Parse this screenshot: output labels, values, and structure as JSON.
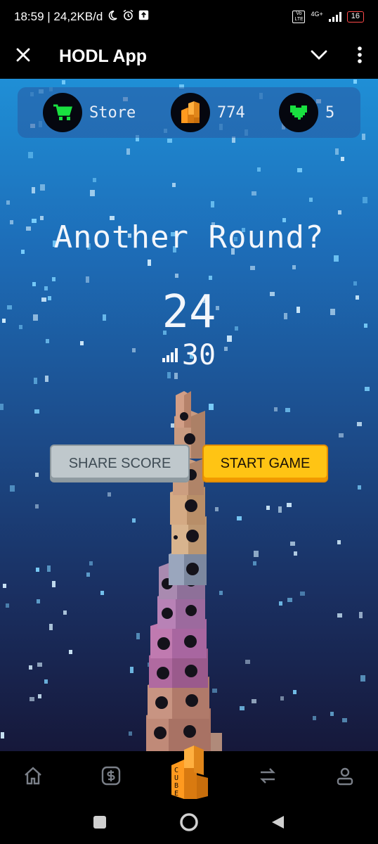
{
  "status_bar": {
    "time_speed": "18:59 | 24,2KB/d",
    "network": "4G+",
    "volte": "Vo LTE",
    "battery": "16"
  },
  "header": {
    "title": "HODL App",
    "close_icon": "close-icon",
    "chevron_icon": "chevron-down-icon",
    "menu_icon": "more-vertical-icon"
  },
  "stats": {
    "store_label": "Store",
    "cubes": "774",
    "lives": "5"
  },
  "game": {
    "headline": "Another Round?",
    "score": "24",
    "best": "30"
  },
  "buttons": {
    "share": "SHARE SCORE",
    "start": "START GAME"
  },
  "bottom_nav": {
    "items": [
      {
        "icon": "home-icon"
      },
      {
        "icon": "dollar-icon"
      },
      {
        "icon": "cube-game-icon",
        "text": "CUBE"
      },
      {
        "icon": "swap-icon"
      },
      {
        "icon": "profile-icon"
      }
    ]
  },
  "colors": {
    "accent_green": "#19e040",
    "cube_orange": "#ff9a1f",
    "start_yellow": "#ffc414"
  }
}
